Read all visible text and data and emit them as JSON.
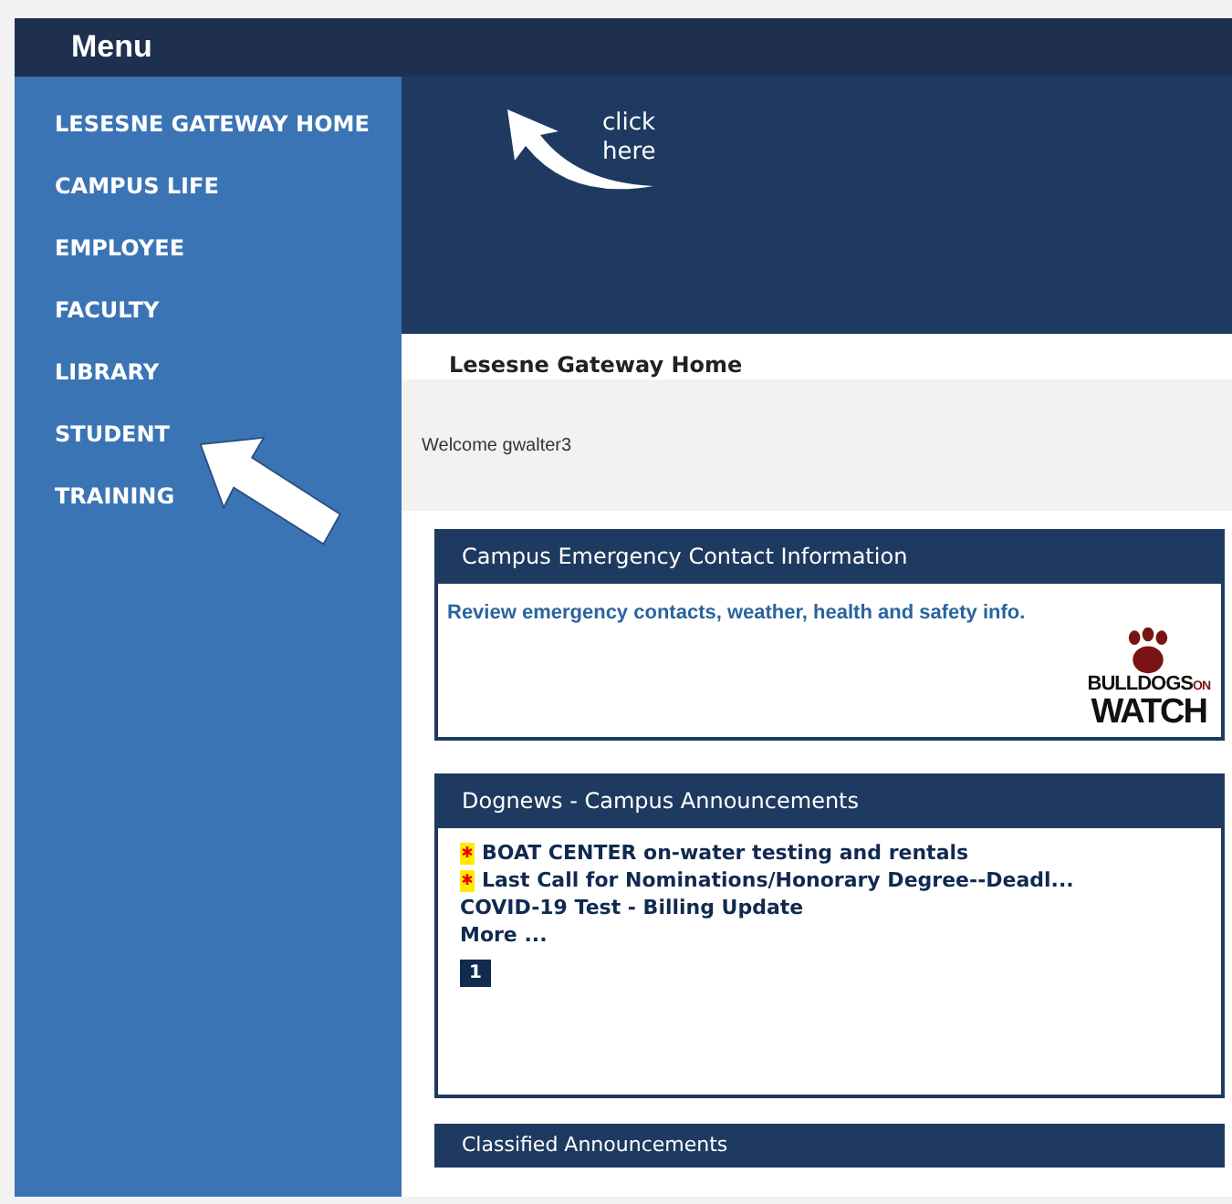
{
  "header": {
    "title": "Menu"
  },
  "sidebar": {
    "items": [
      {
        "label": "LESESNE GATEWAY HOME"
      },
      {
        "label": "CAMPUS LIFE"
      },
      {
        "label": "EMPLOYEE"
      },
      {
        "label": "FACULTY"
      },
      {
        "label": "LIBRARY"
      },
      {
        "label": "STUDENT"
      },
      {
        "label": "TRAINING"
      }
    ]
  },
  "banner": {
    "hint": [
      "click",
      "here"
    ]
  },
  "page": {
    "title": "Lesesne Gateway Home",
    "welcome": "Welcome gwalter3"
  },
  "emergency": {
    "title": "Campus Emergency Contact Information",
    "link": "Review emergency contacts, weather, health and safety info.",
    "logo": {
      "line1": "BULLDOGS",
      "small": "ON",
      "line2": "WATCH"
    }
  },
  "news": {
    "title": "Dognews - Campus Announcements",
    "items": [
      {
        "text": "BOAT CENTER on-water testing and rentals",
        "new": true
      },
      {
        "text": "Last Call for Nominations/Honorary Degree--Deadl...",
        "new": true
      },
      {
        "text": "COVID-19 Test - Billing Update",
        "new": false
      }
    ],
    "more": "More ...",
    "pages": [
      {
        "label": "1",
        "selected": true
      }
    ]
  },
  "classified": {
    "title": "Classified Announcements"
  }
}
